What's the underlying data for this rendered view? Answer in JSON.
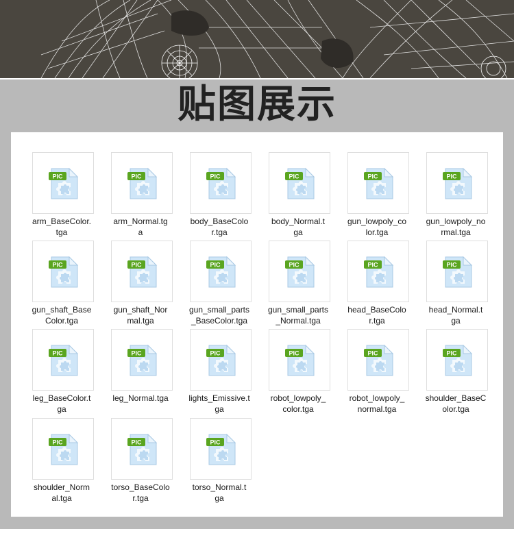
{
  "title": "贴图展示",
  "icon": {
    "name": "pic-file-icon",
    "badge_text": "PIC",
    "badge_color": "#5aa520",
    "page_color": "#cfe6f8",
    "puzzle_color": "#bcd9f1"
  },
  "files": [
    {
      "line1": "arm_BaseColor.",
      "line2": "tga"
    },
    {
      "line1": "arm_Normal.tg",
      "line2": "a"
    },
    {
      "line1": "body_BaseColo",
      "line2": "r.tga"
    },
    {
      "line1": "body_Normal.t",
      "line2": "ga"
    },
    {
      "line1": "gun_lowpoly_co",
      "line2": "lor.tga"
    },
    {
      "line1": "gun_lowpoly_no",
      "line2": "rmal.tga"
    },
    {
      "line1": "gun_shaft_Base",
      "line2": "Color.tga"
    },
    {
      "line1": "gun_shaft_Nor",
      "line2": "mal.tga"
    },
    {
      "line1": "gun_small_parts",
      "line2": "_BaseColor.tga"
    },
    {
      "line1": "gun_small_parts",
      "line2": "_Normal.tga"
    },
    {
      "line1": "head_BaseColo",
      "line2": "r.tga"
    },
    {
      "line1": "head_Normal.t",
      "line2": "ga"
    },
    {
      "line1": "leg_BaseColor.t",
      "line2": "ga"
    },
    {
      "line1": "leg_Normal.tga",
      "line2": ""
    },
    {
      "line1": "lights_Emissive.t",
      "line2": "ga"
    },
    {
      "line1": "robot_lowpoly_",
      "line2": "color.tga"
    },
    {
      "line1": "robot_lowpoly_",
      "line2": "normal.tga"
    },
    {
      "line1": "shoulder_BaseC",
      "line2": "olor.tga"
    },
    {
      "line1": "shoulder_Norm",
      "line2": "al.tga"
    },
    {
      "line1": "torso_BaseColo",
      "line2": "r.tga"
    },
    {
      "line1": "torso_Normal.t",
      "line2": "ga"
    }
  ]
}
